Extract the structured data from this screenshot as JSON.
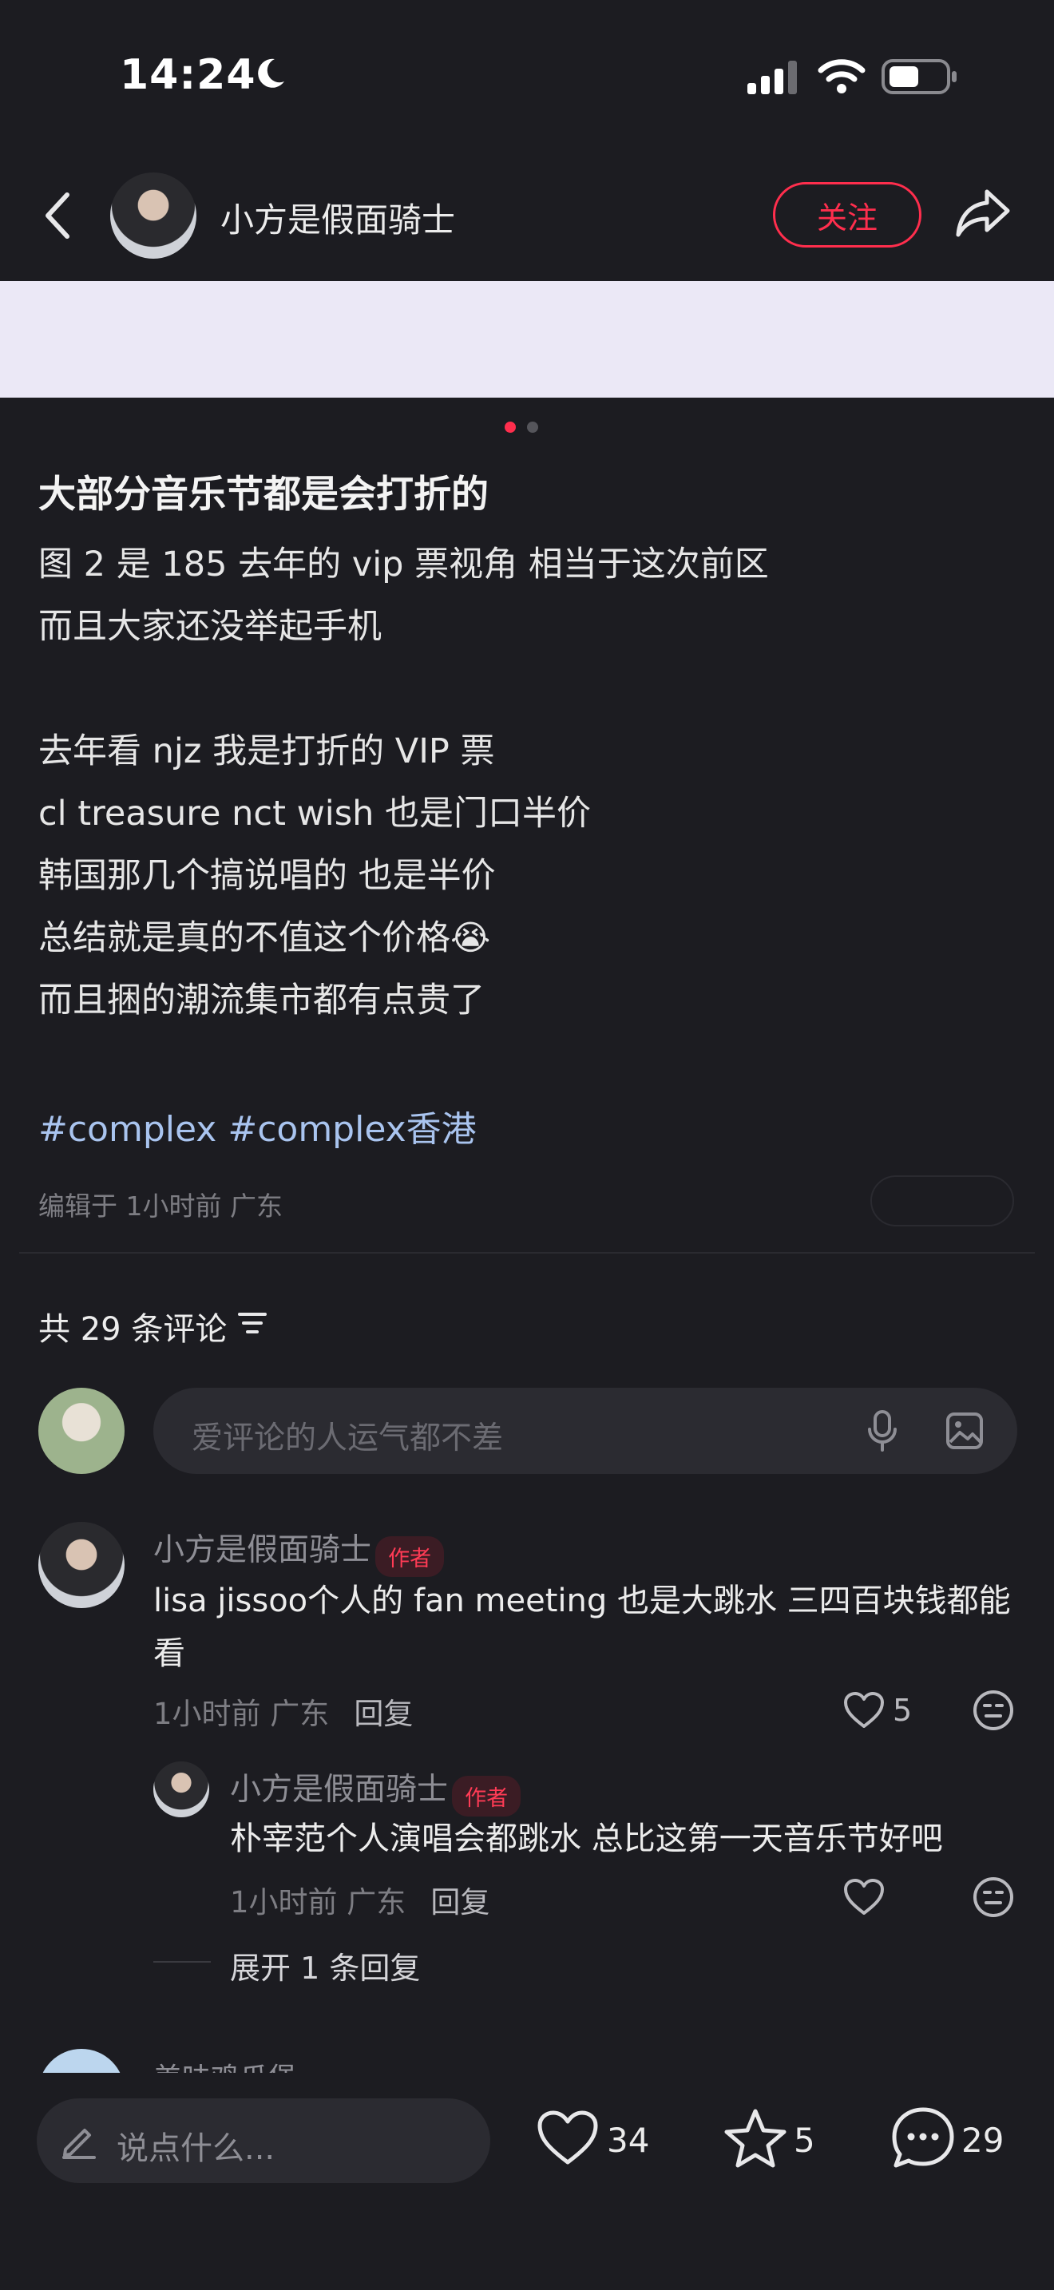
{
  "status_bar": {
    "time": "14:24"
  },
  "header": {
    "author": "小方是假面骑士",
    "follow_label": "关注"
  },
  "post": {
    "title": "大部分音乐节都是会打折的",
    "lines": [
      "图 2 是 185 去年的 vip 票视角 相当于这次前区",
      "而且大家还没举起手机",
      "",
      "去年看 njz 我是打折的 VIP 票",
      "cl treasure nct wish 也是门口半价",
      "韩国那几个搞说唱的 也是半价",
      "总结就是真的不值这个价格😭",
      "而且捆的潮流集市都有点贵了"
    ],
    "tags": [
      "#complex",
      "#complex香港"
    ],
    "meta": "编辑于 1小时前 广东",
    "image_index": 1,
    "image_total": 2
  },
  "comments_section": {
    "count_label": "共 29 条评论",
    "input_placeholder": "爱评论的人运气都不差",
    "comments": [
      {
        "name": "小方是假面骑士",
        "badge": "作者",
        "text_line1": "lisa jissoo个人的 fan meeting 也是大跳水 三四百块钱都能",
        "text_line2": "看",
        "time": "1小时前 广东",
        "reply_label": "回复",
        "likes": "5"
      },
      {
        "name": "小方是假面骑士",
        "badge": "作者",
        "text": "朴宰范个人演唱会都跳水 总比这第一天音乐节好吧",
        "time": "1小时前 广东",
        "reply_label": "回复"
      }
    ],
    "expand_label": "展开 1 条回复",
    "next_partial_name": "美味鸡瓜堡"
  },
  "bottom_bar": {
    "placeholder": "说点什么...",
    "likes": "34",
    "favorites": "5",
    "comments": "29"
  },
  "colors": {
    "accent": "#ff2e4d",
    "tag": "#a9c4ef",
    "background": "#1c1c21"
  }
}
